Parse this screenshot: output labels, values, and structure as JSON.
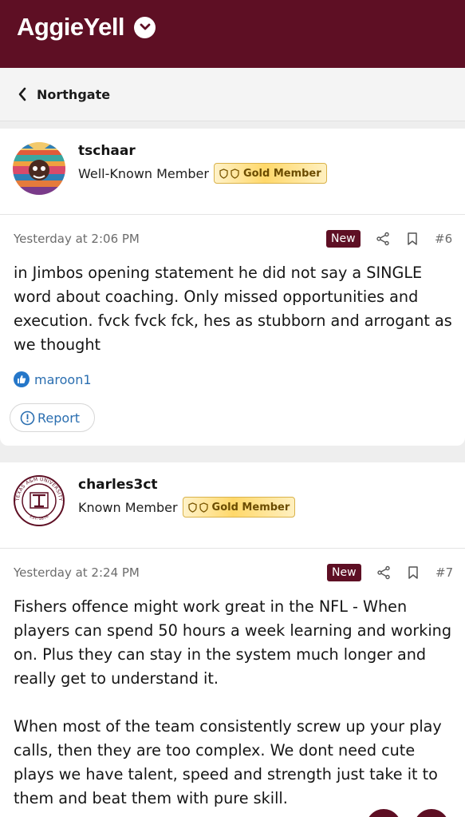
{
  "header": {
    "brand": "AggieYell",
    "brand_menu_icon": "chevron-down-circle-icon",
    "bg_color": "#5e0f24"
  },
  "breadcrumb": {
    "back_icon": "chevron-left-icon",
    "label": "Northgate"
  },
  "posts": [
    {
      "username": "tschaar",
      "user_title": "Well-Known Member",
      "badge": "Gold Member",
      "timestamp": "Yesterday at 2:06 PM",
      "new_label": "New",
      "post_number": "#6",
      "body": [
        "in Jimbos opening statement he did not say a SINGLE word about coaching. Only missed opportunities and execution. fvck fvck fck, hes as stubborn and arrogant as we thought"
      ],
      "reaction_user": "maroon1",
      "report_label": "Report"
    },
    {
      "username": "charles3ct",
      "user_title": "Known Member",
      "badge": "Gold Member",
      "timestamp": "Yesterday at 2:24 PM",
      "new_label": "New",
      "post_number": "#7",
      "avatar_seal": {
        "top": "TEXAS A&M UNIVERSITY",
        "bottom": "EST. 1876"
      },
      "body": [
        "Fishers offence might work great in the NFL - When players can spend 50 hours a week learning and working on. Plus they can stay in the system much longer and really get to understand it.",
        "When most of the team consistently screw up your play calls, then they are too complex. We dont need cute plays we have talent, speed and strength just take it to them and beat them with pure skill."
      ]
    }
  ],
  "colors": {
    "accent": "#5e0f24",
    "link": "#2a6eb0",
    "gold": "#ffd86a"
  }
}
